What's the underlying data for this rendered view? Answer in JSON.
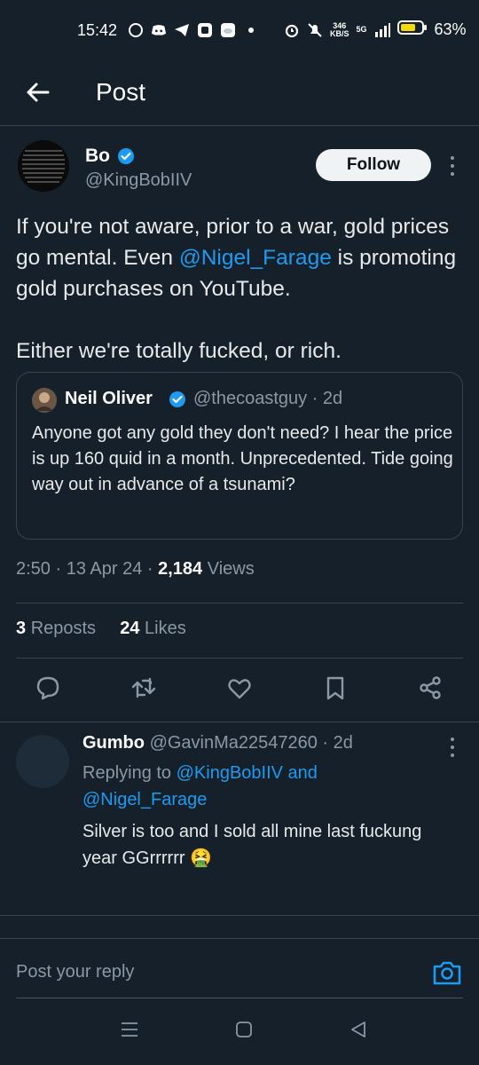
{
  "status_bar": {
    "time": "15:42",
    "speed_value": "346",
    "speed_unit": "KB/S",
    "network": "5G",
    "battery": "63%"
  },
  "header": {
    "title": "Post"
  },
  "post": {
    "author_name": "Bo",
    "author_handle": "@KingBobIIV",
    "follow_label": "Follow",
    "text_part1": "If you're not aware, prior to a war, gold prices go mental. Even ",
    "mention": "@Nigel_Farage",
    "text_part2": " is promoting gold purchases on YouTube.",
    "text_line2": "Either we're totally fucked, or rich.",
    "time": "2:50 · 13 Apr 24 · ",
    "views_count": "2,184",
    "views_label": " Views",
    "reposts_count": "3",
    "reposts_label": "Reposts",
    "likes_count": "24",
    "likes_label": "Likes"
  },
  "quoted": {
    "name": "Neil Oliver",
    "handle_time": "@thecoastguy · 2d",
    "text": "Anyone got any gold they don't need? I hear the price is up 160 quid in a month. Unprecedented. Tide going way out in advance of a tsunami?"
  },
  "reply": {
    "name": "Gumbo",
    "handle_time": "@GavinMa22547260 · 2d",
    "replying_label": "Replying to ",
    "replying_to1": "@KingBobIIV",
    "replying_and": " and ",
    "replying_to2": "@Nigel_Farage",
    "text": "Silver is too and I sold all mine last fuckung year GGrrrrrr 🤮"
  },
  "composer": {
    "placeholder": "Post your reply"
  },
  "colors": {
    "background": "#15202b",
    "accent": "#1d9bf0",
    "muted": "#8b98a5",
    "divider": "#38444d"
  },
  "icons": [
    "back-arrow-icon",
    "verified-badge-icon",
    "more-options-icon",
    "reply-icon",
    "repost-icon",
    "like-icon",
    "bookmark-icon",
    "share-icon",
    "camera-icon"
  ]
}
